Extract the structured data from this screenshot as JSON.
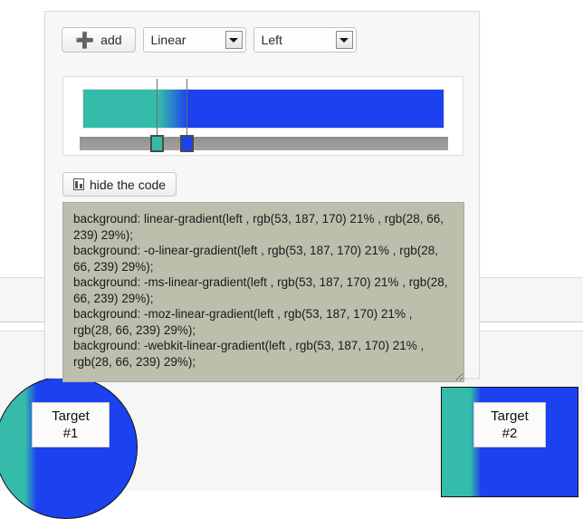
{
  "toolbar": {
    "add_label": "add",
    "add_icon": "plus-icon",
    "gradient_type": "Linear",
    "gradient_type_options": [
      "Linear"
    ],
    "direction": "Left",
    "direction_options": [
      "Left"
    ]
  },
  "editor": {
    "stops": [
      {
        "color": "#35bbaa",
        "position_pct": 21,
        "rgb_text": "rgb(53, 187, 170)"
      },
      {
        "color": "#1c42ef",
        "position_pct": 29,
        "rgb_text": "rgb(28, 66, 239)"
      }
    ],
    "gradient_css": "linear-gradient(90deg, #35bbaa 21%, #1c42ef 29%)",
    "track_color": "#999999"
  },
  "hide_code_button": {
    "label": "hide the code",
    "icon": "document-code-icon"
  },
  "code": {
    "text": "background: linear-gradient(left , rgb(53, 187, 170) 21% , rgb(28, 66, 239) 29%);\nbackground: -o-linear-gradient(left , rgb(53, 187, 170) 21% , rgb(28, 66, 239) 29%);\nbackground: -ms-linear-gradient(left , rgb(53, 187, 170) 21% , rgb(28, 66, 239) 29%);\nbackground: -moz-linear-gradient(left , rgb(53, 187, 170) 21% , rgb(28, 66, 239) 29%);\nbackground: -webkit-linear-gradient(left , rgb(53, 187, 170) 21% , rgb(28, 66, 239) 29%);"
  },
  "targets": [
    {
      "label": "Target\n#1",
      "shape": "circle"
    },
    {
      "label": "Target\n#2",
      "shape": "rectangle"
    }
  ],
  "colors": {
    "teal": "#35bbaa",
    "blue": "#1c42ef",
    "code_bg": "#bdbfad",
    "panel_bg": "#f7f7f7"
  }
}
